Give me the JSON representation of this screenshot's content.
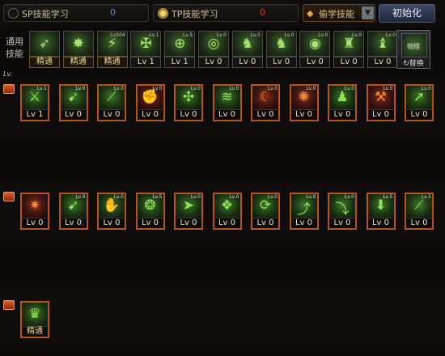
{
  "tabs": {
    "sp": {
      "label": "SP技能学习",
      "count": "0",
      "selected": false
    },
    "tp": {
      "label": "TP技能学习",
      "count": "0",
      "selected": true
    }
  },
  "steal_dropdown": {
    "label": "偷学技能",
    "icon": "diamond-icon"
  },
  "init_button": "初始化",
  "common_section_label": "通用技能",
  "common_skills": [
    {
      "tag": "",
      "level": "精通",
      "mastered": true,
      "icon": "dash-icon"
    },
    {
      "tag": "",
      "level": "精通",
      "mastered": true,
      "icon": "flame-icon"
    },
    {
      "tag": "Lv104",
      "level": "精通",
      "mastered": true,
      "icon": "strike-icon"
    },
    {
      "tag": "Lv.1",
      "level": "Lv 1",
      "mastered": false,
      "icon": "wings-icon"
    },
    {
      "tag": "Lv.5",
      "level": "Lv 1",
      "mastered": false,
      "icon": "crosshair-icon"
    },
    {
      "tag": "Lv.0",
      "level": "Lv 0",
      "mastered": false,
      "icon": "target-icon"
    },
    {
      "tag": "Lv.0",
      "level": "Lv 0",
      "mastered": false,
      "icon": "figure-icon"
    },
    {
      "tag": "Lv.0",
      "level": "Lv 0",
      "mastered": false,
      "icon": "figure-icon"
    },
    {
      "tag": "Lv.0",
      "level": "Lv 0",
      "mastered": false,
      "icon": "orb-icon"
    },
    {
      "tag": "Lv.0",
      "level": "Lv 0",
      "mastered": false,
      "icon": "armor-icon"
    },
    {
      "tag": "Lv.0",
      "level": "Lv 0",
      "mastered": false,
      "icon": "totem-icon"
    }
  ],
  "switch_button": {
    "icon_text": "物理",
    "label": "↻替换"
  },
  "lv_marker": "Lv.",
  "row1_skills": [
    {
      "tag": "Lv.1",
      "level": "Lv 1",
      "icon": "slash-icon",
      "tone": "green"
    },
    {
      "tag": "Lv.0",
      "level": "Lv 0",
      "icon": "kick-icon",
      "tone": "green"
    },
    {
      "tag": "Lv.0",
      "level": "Lv 0",
      "icon": "blade-icon",
      "tone": "green"
    },
    {
      "tag": "Lv.0",
      "level": "Lv 0",
      "icon": "fist-icon",
      "tone": "red"
    },
    {
      "tag": "Lv.0",
      "level": "Lv 0",
      "icon": "spin-icon",
      "tone": "green"
    },
    {
      "tag": "Lv.0",
      "level": "Lv 0",
      "icon": "wave-icon",
      "tone": "green"
    },
    {
      "tag": "Lv.0",
      "level": "Lv 0",
      "icon": "crescent-icon",
      "tone": "red"
    },
    {
      "tag": "Lv.0",
      "level": "Lv 0",
      "icon": "burst-icon",
      "tone": "red"
    },
    {
      "tag": "Lv.0",
      "level": "Lv 0",
      "icon": "body-icon",
      "tone": "green"
    },
    {
      "tag": "Lv.0",
      "level": "Lv 0",
      "icon": "claw-icon",
      "tone": "red"
    },
    {
      "tag": "Lv.0",
      "level": "Lv 0",
      "icon": "leap-icon",
      "tone": "green"
    }
  ],
  "row2_skills": [
    {
      "tag": "",
      "level": "Lv 0",
      "icon": "spark-icon",
      "tone": "red"
    },
    {
      "tag": "Lv.0",
      "level": "Lv 0",
      "icon": "kick-icon",
      "tone": "green"
    },
    {
      "tag": "Lv.0",
      "level": "Lv 0",
      "icon": "grab-icon",
      "tone": "green"
    },
    {
      "tag": "Lv.5",
      "level": "Lv 0",
      "icon": "wind-icon",
      "tone": "green"
    },
    {
      "tag": "Lv.0",
      "level": "Lv 0",
      "icon": "rush-icon",
      "tone": "green"
    },
    {
      "tag": "Lv.0",
      "level": "Lv 0",
      "icon": "throw-icon",
      "tone": "green"
    },
    {
      "tag": "Lv.0",
      "level": "Lv 0",
      "icon": "flip-icon",
      "tone": "green"
    },
    {
      "tag": "Lv.0",
      "level": "Lv 0",
      "icon": "uppercut-icon",
      "tone": "green"
    },
    {
      "tag": "Lv.0",
      "level": "Lv 0",
      "icon": "dive-icon",
      "tone": "green"
    },
    {
      "tag": "Lv.5",
      "level": "Lv 0",
      "icon": "slam-icon",
      "tone": "green"
    },
    {
      "tag": "Lv.5",
      "level": "Lv 0",
      "icon": "blade-icon",
      "tone": "green"
    }
  ],
  "row3_skills": [
    {
      "tag": "",
      "level": "精通",
      "icon": "awaken-icon",
      "tone": "green",
      "mastered": true
    }
  ]
}
